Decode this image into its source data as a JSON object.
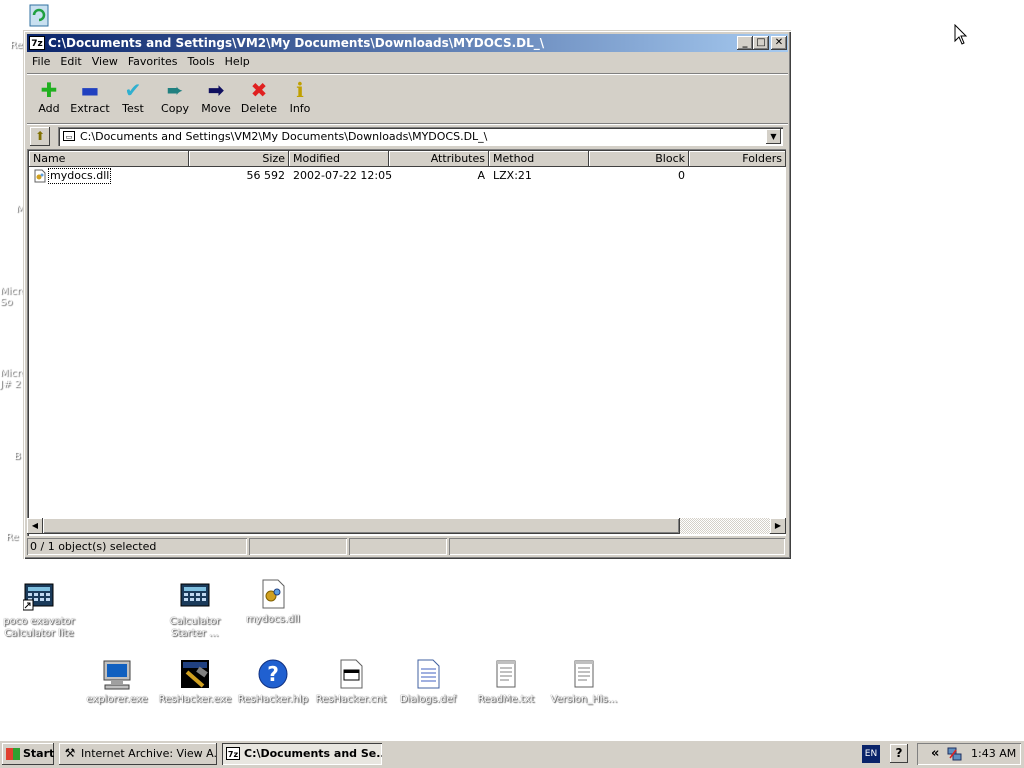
{
  "window": {
    "title": "C:\\Documents and Settings\\VM2\\My Documents\\Downloads\\MYDOCS.DL_\\",
    "app_icon": "7z",
    "minimize": "_",
    "maximize": "□",
    "close": "✕"
  },
  "menu": [
    "File",
    "Edit",
    "View",
    "Favorites",
    "Tools",
    "Help"
  ],
  "toolbar": [
    {
      "label": "Add",
      "icon": "plus-icon",
      "glyph": "✚",
      "color": "#20b020"
    },
    {
      "label": "Extract",
      "icon": "minus-icon",
      "glyph": "▬",
      "color": "#2040c0"
    },
    {
      "label": "Test",
      "icon": "check-icon",
      "glyph": "✔",
      "color": "#30b0d0"
    },
    {
      "label": "Copy",
      "icon": "copy-arrow-icon",
      "glyph": "➨",
      "color": "#208080"
    },
    {
      "label": "Move",
      "icon": "move-arrow-icon",
      "glyph": "➡",
      "color": "#101060"
    },
    {
      "label": "Delete",
      "icon": "x-icon",
      "glyph": "✖",
      "color": "#e02020"
    },
    {
      "label": "Info",
      "icon": "info-icon",
      "glyph": "ℹ",
      "color": "#c0a000"
    }
  ],
  "address": {
    "path": "C:\\Documents and Settings\\VM2\\My Documents\\Downloads\\MYDOCS.DL_\\"
  },
  "list": {
    "columns": [
      "Name",
      "Size",
      "Modified",
      "Attributes",
      "Method",
      "Block",
      "Folders"
    ],
    "rows": [
      {
        "name": "mydocs.dll",
        "size": "56 592",
        "modified": "2002-07-22 12:05",
        "attributes": "A",
        "method": "LZX:21",
        "block": "0",
        "folders": ""
      }
    ]
  },
  "status": {
    "selected": "0 / 1 object(s) selected"
  },
  "desktop": {
    "icons": [
      {
        "label": "poco exavator\nCalculator lite",
        "kind": "calculator-icon"
      },
      {
        "label": "Calculator\nStarter ...",
        "kind": "calculator-icon"
      },
      {
        "label": "mydocs.dll",
        "kind": "dll-icon"
      },
      {
        "label": "explorer.exe",
        "kind": "computer-icon"
      },
      {
        "label": "ResHacker.exe",
        "kind": "reshacker-icon"
      },
      {
        "label": "ResHacker.hlp",
        "kind": "help-icon"
      },
      {
        "label": "ResHacker.cnt",
        "kind": "cnt-file-icon"
      },
      {
        "label": "Dialogs.def",
        "kind": "def-file-icon"
      },
      {
        "label": "ReadMe.txt",
        "kind": "text-file-icon"
      },
      {
        "label": "Version_His...",
        "kind": "text-file-icon"
      }
    ],
    "partial_labels": [
      "Re",
      "M",
      "Micro\nSo",
      "Micro\nJ# 2",
      "B",
      "Re"
    ]
  },
  "taskbar": {
    "start": "Start",
    "tasks": [
      {
        "label": "Internet Archive: View A...",
        "active": false
      },
      {
        "label": "C:\\Documents and Se...",
        "active": true
      }
    ],
    "lang": "EN",
    "help": "?",
    "chevron": "«",
    "clock": "1:43 AM"
  }
}
